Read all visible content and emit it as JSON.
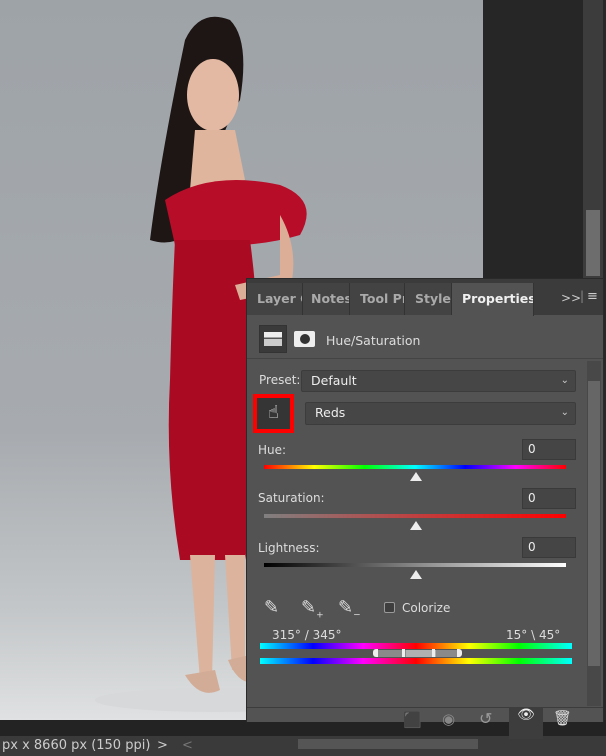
{
  "status": {
    "dimensions": "px x 8660 px (150 ppi)",
    "arrow_right": ">",
    "arrow_left": "<"
  },
  "panel": {
    "tabs": [
      {
        "label": "Layer C"
      },
      {
        "label": "Notes"
      },
      {
        "label": "Tool Pr"
      },
      {
        "label": "Styles"
      },
      {
        "label": "Properties",
        "active": true
      }
    ],
    "tab_menu": ">>",
    "title": "Hue/Saturation",
    "preset_label": "Preset:",
    "preset_value": "Default",
    "range_value": "Reds",
    "hue": {
      "label": "Hue:",
      "value": "0"
    },
    "saturation": {
      "label": "Saturation:",
      "value": "0"
    },
    "lightness": {
      "label": "Lightness:",
      "value": "0"
    },
    "colorize_label": "Colorize",
    "colorize_checked": false,
    "range_left": "315° / 345°",
    "range_right": "15° \\ 45°",
    "accent": "#ff0000"
  }
}
